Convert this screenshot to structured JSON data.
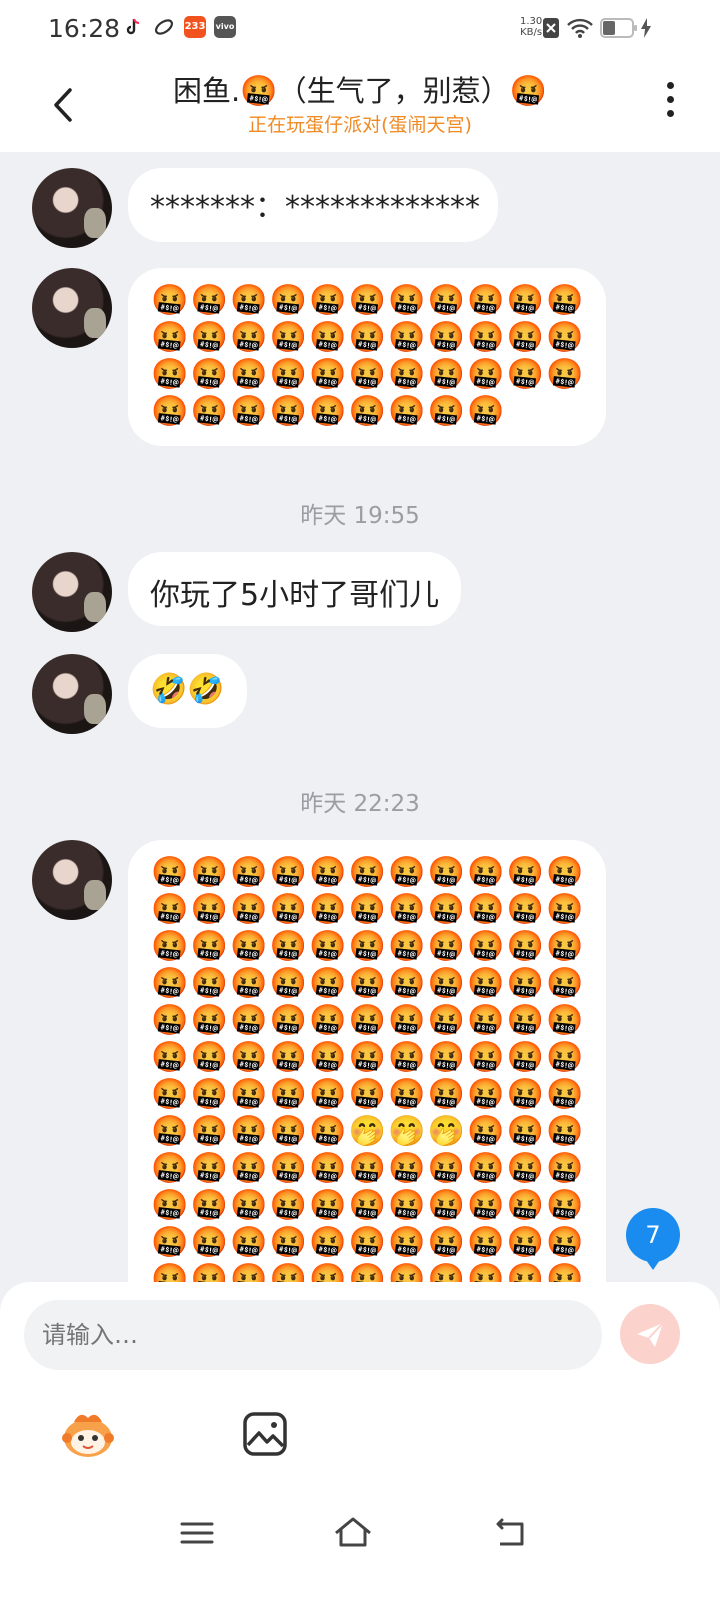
{
  "status_bar": {
    "time": "16:28",
    "app_icons": [
      "tiktok-icon",
      "link-icon",
      "233-icon",
      "vivo-icon"
    ],
    "badge_233": "233",
    "badge_vivo": "vivo",
    "net_speed_value": "1.30",
    "net_speed_unit": "KB/s",
    "right_icons": [
      "sim-x-icon",
      "wifi-icon",
      "battery-icon",
      "charging-icon"
    ]
  },
  "header": {
    "title_name": "困鱼.",
    "title_emoji": "🤬",
    "title_note": "（生气了，别惹）",
    "subtitle": "正在玩蛋仔派对(蛋闹天宫)"
  },
  "messages": [
    {
      "type": "text",
      "text": "*******：*************"
    },
    {
      "type": "emoji",
      "rows": [
        11,
        11,
        11,
        9
      ],
      "emoji": "🤬"
    },
    {
      "type": "timestamp",
      "text": "昨天 19:55"
    },
    {
      "type": "text",
      "text": "你玩了5小时了哥们儿"
    },
    {
      "type": "text",
      "text": "🤣🤣"
    },
    {
      "type": "timestamp",
      "text": "昨天 22:23"
    },
    {
      "type": "emoji",
      "emoji": "🤬",
      "alt_emoji": "🤭",
      "rows": [
        11,
        11,
        11,
        11,
        11,
        11,
        11,
        11,
        11,
        11,
        11,
        11
      ],
      "alt_positions": [
        [
          7,
          5
        ],
        [
          7,
          6
        ],
        [
          7,
          7
        ]
      ]
    }
  ],
  "unread_badge": "7",
  "input": {
    "placeholder": "请输入…"
  },
  "toolbar": {
    "icons": [
      "mascot-emoji-icon",
      "image-icon"
    ]
  },
  "nav_bar": {
    "icons": [
      "menu-icon",
      "home-icon",
      "back-nav-icon"
    ]
  },
  "colors": {
    "accent_orange": "#f08a24",
    "badge_blue": "#1a8cf0",
    "send_disabled": "#fbd2cc",
    "background": "#eef0f3"
  }
}
